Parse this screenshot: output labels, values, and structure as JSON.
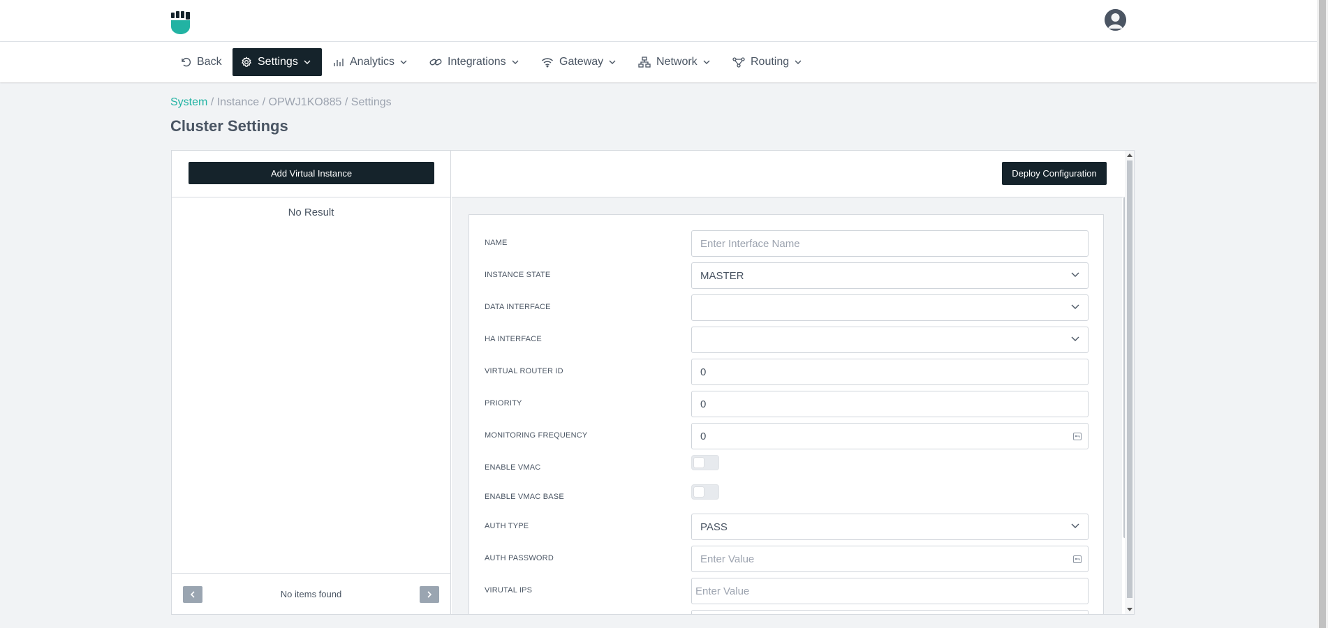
{
  "colors": {
    "dark": "#15232b",
    "accent": "#22b3a3",
    "muted": "#9ca3af"
  },
  "header": {
    "logo_icon": "fist-shield-icon",
    "avatar_icon": "user-avatar-icon"
  },
  "nav": {
    "items": [
      {
        "label": "Back",
        "icon": "undo-icon"
      },
      {
        "label": "Settings",
        "icon": "gear-icon",
        "active": true
      },
      {
        "label": "Analytics",
        "icon": "bar-chart-icon"
      },
      {
        "label": "Integrations",
        "icon": "link-icon"
      },
      {
        "label": "Gateway",
        "icon": "wifi-icon"
      },
      {
        "label": "Network",
        "icon": "network-icon"
      },
      {
        "label": "Routing",
        "icon": "routing-icon"
      }
    ]
  },
  "breadcrumb": {
    "system": "System",
    "instance": "Instance",
    "id": "OPWJ1KO885",
    "settings": "Settings",
    "separator": " / "
  },
  "page": {
    "title": "Cluster Settings"
  },
  "left_panel": {
    "add_button": "Add Virtual Instance",
    "empty_text": "No Result",
    "pager_text": "No items found"
  },
  "right_panel": {
    "deploy_button": "Deploy Configuration"
  },
  "form": {
    "name": {
      "label": "NAME",
      "placeholder": "Enter Interface Name"
    },
    "instance_state": {
      "label": "INSTANCE STATE",
      "value": "MASTER"
    },
    "data_interface": {
      "label": "DATA INTERFACE",
      "value": ""
    },
    "ha_interface": {
      "label": "HA INTERFACE",
      "value": ""
    },
    "virtual_router_id": {
      "label": "VIRTUAL ROUTER ID",
      "value": "0"
    },
    "priority": {
      "label": "PRIORITY",
      "value": "0"
    },
    "monitoring_frequency": {
      "label": "MONITORING FREQUENCY",
      "value": "0"
    },
    "enable_vmac": {
      "label": "ENABLE VMAC",
      "on": false
    },
    "enable_vmac_base": {
      "label": "ENABLE VMAC BASE",
      "on": false
    },
    "auth_type": {
      "label": "AUTH TYPE",
      "value": "PASS"
    },
    "auth_password": {
      "label": "AUTH PASSWORD",
      "placeholder": "Enter Value"
    },
    "virtual_ips": {
      "label": "VIRUTAL IPS",
      "placeholder": "Enter Value"
    }
  }
}
